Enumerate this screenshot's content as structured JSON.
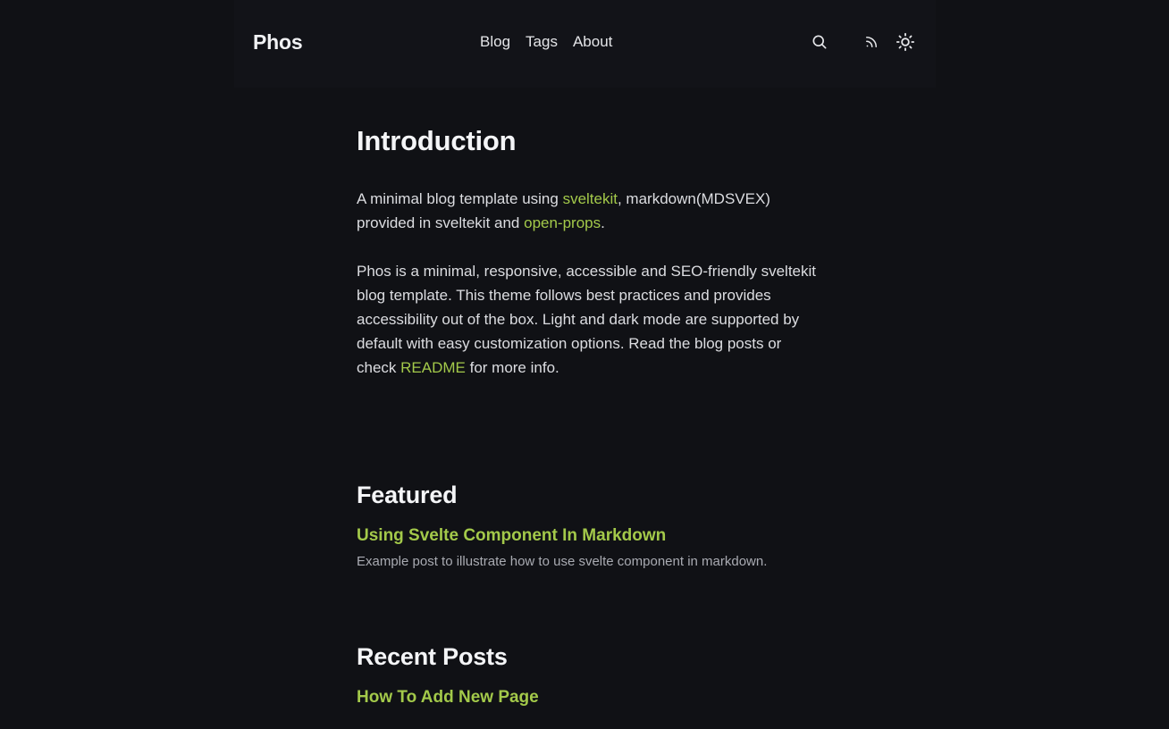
{
  "header": {
    "brand": "Phos",
    "nav": [
      "Blog",
      "Tags",
      "About"
    ],
    "icons": [
      "search-icon",
      "rss-icon",
      "sun-icon"
    ]
  },
  "intro": {
    "title": "Introduction",
    "p1_a": "A minimal blog template using ",
    "p1_link1": "sveltekit",
    "p1_b": ", markdown(MDSVEX) provided in sveltekit and ",
    "p1_link2": "open-props",
    "p1_c": ".",
    "p2_a": "Phos is a minimal, responsive, accessible and SEO-friendly sveltekit blog template. This theme follows best practices and provides accessibility out of the box. Light and dark mode are supported by default with easy customization options. Read the blog posts or check ",
    "p2_link": "README",
    "p2_b": " for more info."
  },
  "featured": {
    "title": "Featured",
    "posts": [
      {
        "title": "Using Svelte Component In Markdown",
        "description": "Example post to illustrate how to use svelte component in markdown."
      }
    ]
  },
  "recent": {
    "title": "Recent Posts",
    "posts": [
      {
        "title": "How To Add New Page"
      }
    ]
  },
  "colors": {
    "background": "#101115",
    "accent": "#a3c94a",
    "text": "#dcdde1"
  }
}
